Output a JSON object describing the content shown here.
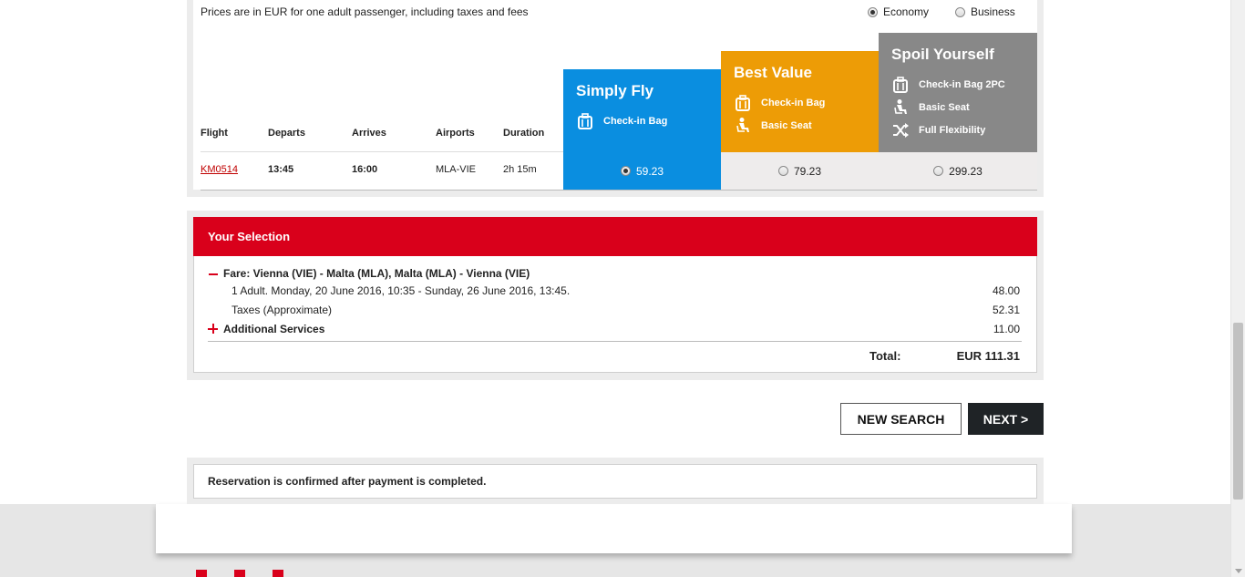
{
  "prices_note": "Prices are in EUR for one adult passenger, including taxes and fees",
  "cabin": {
    "economy_label": "Economy",
    "business_label": "Business",
    "selected": "Economy"
  },
  "table": {
    "headers": {
      "flight": "Flight",
      "departs": "Departs",
      "arrives": "Arrives",
      "airports": "Airports",
      "duration": "Duration"
    },
    "row": {
      "flight": "KM0514",
      "departs": "13:45",
      "arrives": "16:00",
      "airports": "MLA-VIE",
      "duration": "2h 15m"
    }
  },
  "fares": [
    {
      "name": "Simply Fly",
      "color": "#0a8ee0",
      "features": [
        {
          "icon": "luggage-icon",
          "label": "Check-in Bag"
        }
      ],
      "price": "59.23",
      "selected": true
    },
    {
      "name": "Best Value",
      "color": "#ed9c06",
      "features": [
        {
          "icon": "luggage-icon",
          "label": "Check-in Bag"
        },
        {
          "icon": "seat-icon",
          "label": "Basic Seat"
        }
      ],
      "price": "79.23",
      "selected": false
    },
    {
      "name": "Spoil Yourself",
      "color": "#888888",
      "features": [
        {
          "icon": "luggage-icon",
          "label": "Check-in Bag 2PC"
        },
        {
          "icon": "seat-icon",
          "label": "Basic Seat"
        },
        {
          "icon": "shuffle-icon",
          "label": "Full Flexibility"
        }
      ],
      "price": "299.23",
      "selected": false
    }
  ],
  "selection": {
    "title": "Your Selection",
    "fare_label": "Fare: Vienna (VIE) - Malta (MLA), Malta (MLA) - Vienna (VIE)",
    "fare_detail": "1 Adult. Monday, 20 June 2016, 10:35 - Sunday, 26 June 2016, 13:45.",
    "fare_amount": "48.00",
    "taxes_label": "Taxes (Approximate)",
    "taxes_amount": "52.31",
    "additional_label": "Additional Services",
    "additional_amount": "11.00",
    "total_label": "Total:",
    "total_amount": "EUR 111.31"
  },
  "buttons": {
    "new_search": "NEW SEARCH",
    "next": "NEXT >"
  },
  "notice": "Reservation is confirmed after payment is completed.",
  "accent_color": "#d9001b"
}
